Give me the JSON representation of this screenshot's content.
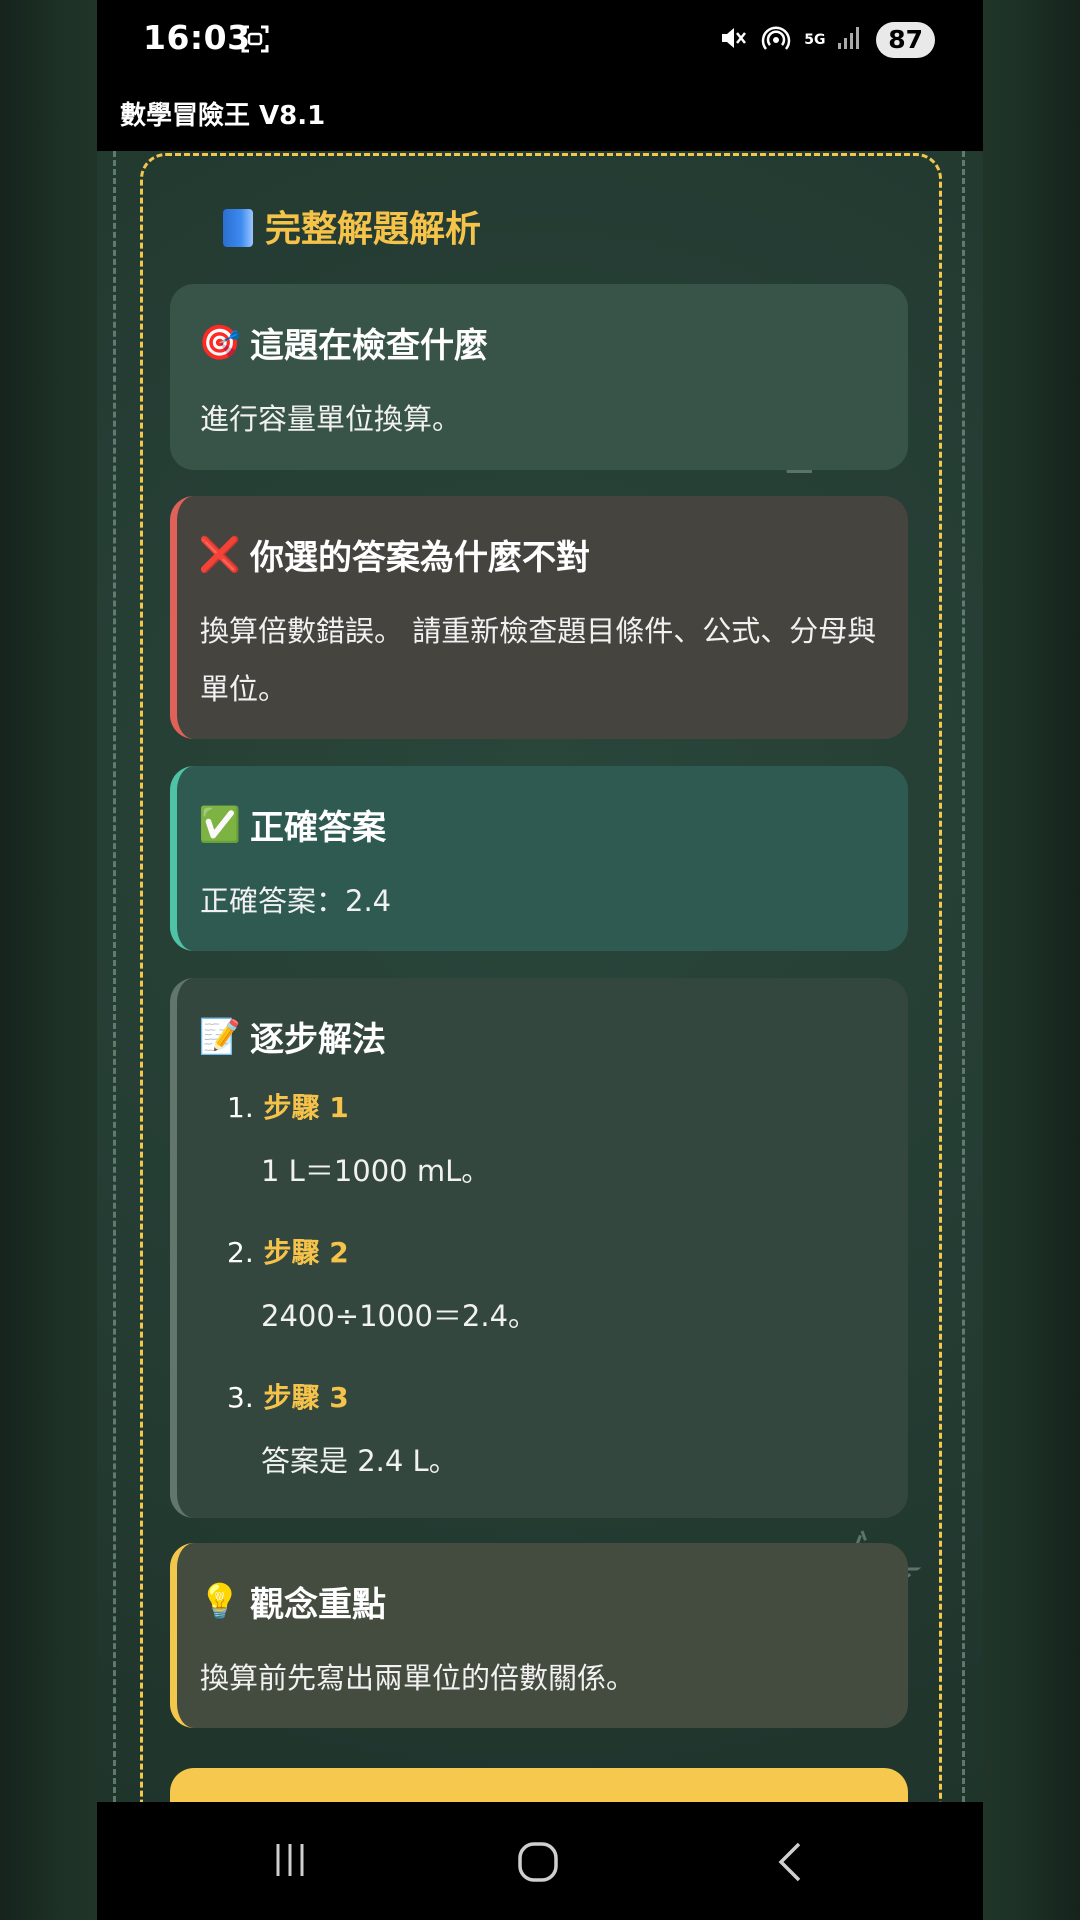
{
  "status_bar": {
    "time": "16:03",
    "network": "5G",
    "battery": "87",
    "icons": [
      "screenshot-icon",
      "mute-icon",
      "hotspot-icon",
      "signal-icon"
    ]
  },
  "app": {
    "title": "數學冒險王 V8.1"
  },
  "panel": {
    "title": "完整解題解析",
    "title_icon": "book-icon"
  },
  "cards": {
    "check": {
      "icon": "🎯",
      "title": "這題在檢查什麼",
      "body": "進行容量單位換算。"
    },
    "wrong": {
      "icon": "❌",
      "title": "你選的答案為什麼不對",
      "body": "換算倍數錯誤。 請重新檢查題目條件、公式、分母與單位。"
    },
    "correct": {
      "icon": "✅",
      "title": "正確答案",
      "body": "正確答案：2.4"
    },
    "steps": {
      "icon": "📝",
      "title": "逐步解法",
      "items": [
        {
          "num": "1.",
          "label": "步驟 1",
          "text": "1 L＝1000 mL。"
        },
        {
          "num": "2.",
          "label": "步驟 2",
          "text": "2400÷1000＝2.4。"
        },
        {
          "num": "3.",
          "label": "步驟 3",
          "text": "答案是 2.4 L。"
        }
      ]
    },
    "concept": {
      "icon": "💡",
      "title": "觀念重點",
      "body": "換算前先寫出兩單位的倍數關係。"
    }
  },
  "colors": {
    "accent_yellow": "#f5c34a",
    "wrong_red": "#e0605a",
    "correct_teal": "#4fc3a6",
    "chalkboard": "#253d33"
  },
  "nav": [
    "recent-apps-button",
    "home-button",
    "back-button"
  ]
}
